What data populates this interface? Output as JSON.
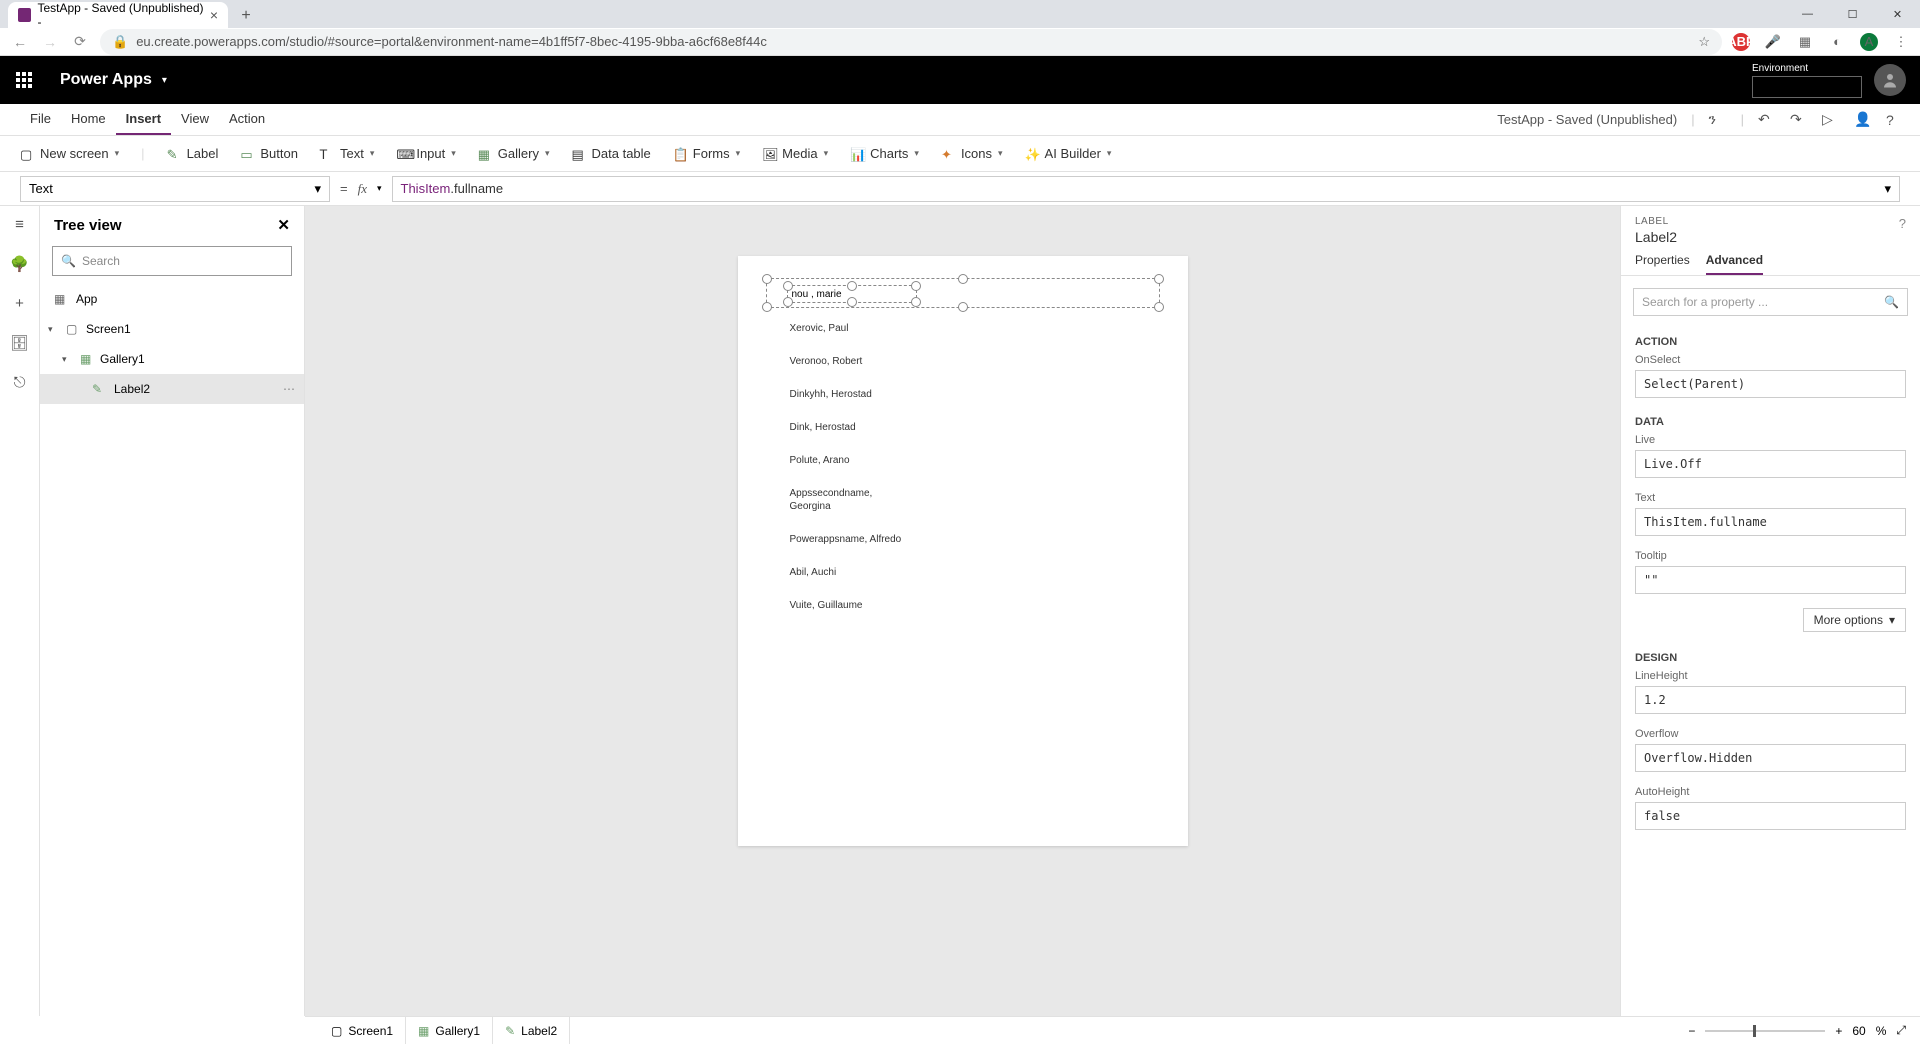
{
  "browser": {
    "tab_title": "TestApp - Saved (Unpublished) - ",
    "url": "eu.create.powerapps.com/studio/#source=portal&environment-name=4b1ff5f7-8bec-4195-9bba-a6cf68e8f44c",
    "avatar_letter": "A"
  },
  "top_bar": {
    "brand": "Power Apps",
    "env_label": "Environment"
  },
  "menu": {
    "items": [
      "File",
      "Home",
      "Insert",
      "View",
      "Action"
    ],
    "active_index": 2,
    "app_title": "TestApp - Saved (Unpublished)"
  },
  "ribbon": {
    "new_screen": "New screen",
    "label": "Label",
    "button": "Button",
    "text": "Text",
    "input": "Input",
    "gallery": "Gallery",
    "data_table": "Data table",
    "forms": "Forms",
    "media": "Media",
    "charts": "Charts",
    "icons": "Icons",
    "ai_builder": "AI Builder"
  },
  "formula_bar": {
    "property": "Text",
    "fx_prefix": "ThisItem",
    "fx_suffix": ".fullname"
  },
  "tree": {
    "title": "Tree view",
    "search_placeholder": "Search",
    "app": "App",
    "screen": "Screen1",
    "gallery": "Gallery1",
    "label": "Label2"
  },
  "canvas": {
    "selected_text": "nou   , marie",
    "items": [
      "Xerovic, Paul",
      "Veronoo, Robert",
      "Dinkyhh, Herostad",
      "Dink, Herostad",
      "Polute, Arano",
      "Appssecondname, Georgina",
      "Powerappsname, Alfredo",
      "Abil, Auchi",
      "Vuite, Guillaume"
    ]
  },
  "rpanel": {
    "category": "LABEL",
    "name": "Label2",
    "tabs": {
      "properties": "Properties",
      "advanced": "Advanced"
    },
    "search_placeholder": "Search for a property ...",
    "sections": {
      "action": "ACTION",
      "data": "DATA",
      "design": "DESIGN"
    },
    "props": {
      "onselect_label": "OnSelect",
      "onselect_value": "Select(Parent)",
      "live_label": "Live",
      "live_value": "Live.Off",
      "text_label": "Text",
      "text_value": "ThisItem.fullname",
      "tooltip_label": "Tooltip",
      "tooltip_value": "\"\"",
      "lineheight_label": "LineHeight",
      "lineheight_value": "1.2",
      "overflow_label": "Overflow",
      "overflow_value": "Overflow.Hidden",
      "autoheight_label": "AutoHeight",
      "autoheight_value": "false"
    },
    "more_options": "More options"
  },
  "status": {
    "screen": "Screen1",
    "gallery": "Gallery1",
    "label": "Label2",
    "zoom": "60",
    "zoom_pct": "%"
  }
}
